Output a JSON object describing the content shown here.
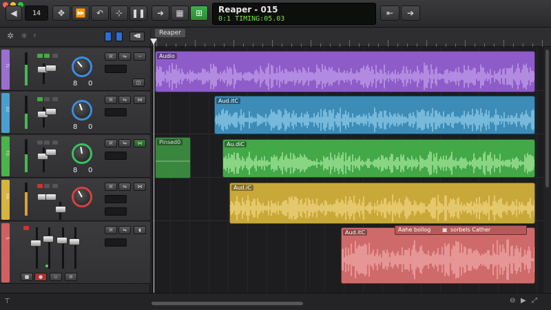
{
  "window": {
    "title": "Reaper - 015",
    "subtitle": "0:1 TIMING:05.03"
  },
  "transport": {
    "counter": "14",
    "back_icon": "triangle-left-icon"
  },
  "ruler": {
    "marker_label": "Reaper"
  },
  "tracks": [
    {
      "color": "#9a6fd1",
      "number": "TL",
      "knob_color": "#3a8de0",
      "pan_left": "8",
      "pan_right": "0"
    },
    {
      "color": "#4a9fcf",
      "number": "02",
      "knob_color": "#3a8de0",
      "pan_left": "8",
      "pan_right": "0"
    },
    {
      "color": "#4cb24c",
      "number": "TD",
      "knob_color": "#3cc060",
      "pan_left": "8",
      "pan_right": "0"
    },
    {
      "color": "#d7b340",
      "number": "0A",
      "knob_color": "#d94040",
      "pan_left": "",
      "pan_right": ""
    },
    {
      "color": "#d06060",
      "number": "5",
      "knob_color": "#aaaaaa",
      "pan_left": "",
      "pan_right": ""
    }
  ],
  "clips": [
    {
      "label": "Audio",
      "color": "#8e5cc8"
    },
    {
      "label": "Aud.itC",
      "color": "#3d8cb8"
    },
    {
      "label": "Pinsed0",
      "color": "#3f9a45"
    },
    {
      "label": "Au.diC",
      "color": "#43a848"
    },
    {
      "label": "Aud.iC",
      "color": "#c9a83a"
    },
    {
      "label": "Aud.itC",
      "color": "#cf6a6a"
    },
    {
      "label": "Aahe bollog",
      "color": "#b55a5a"
    },
    {
      "label": "sorbels Cather",
      "color": "#b55a5a"
    }
  ]
}
